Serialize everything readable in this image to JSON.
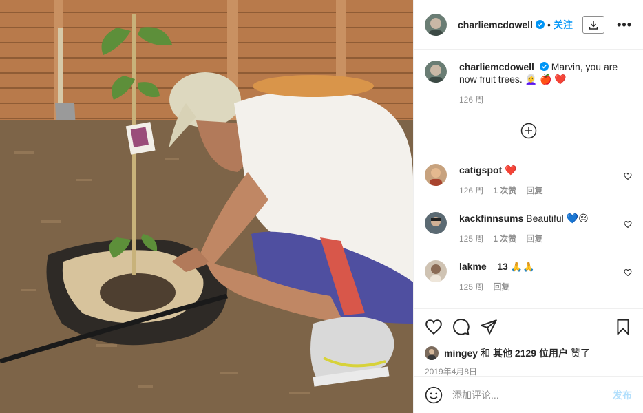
{
  "post": {
    "photo_icon": "photo"
  },
  "header": {
    "username": "charliemcdowell",
    "dot": "•",
    "follow_label": "关注",
    "download_icon": "download-icon",
    "more_label": "•••"
  },
  "caption": {
    "username": "charliemcdowell",
    "text": "Marvin, you are now fruit trees.",
    "emojis": "👩‍🦳 🍎 ❤️",
    "time": "126 周"
  },
  "comments": [
    {
      "username": "catigspot",
      "text": "",
      "emojis": "❤️",
      "time": "126 周",
      "likes": "",
      "reply": "回复"
    },
    {
      "username": "kackfinnsums",
      "text": "Beautiful",
      "emojis": "💙😔",
      "time": "125 周",
      "likes": "1 次赞",
      "reply": "回复"
    },
    {
      "username": "lakme__13",
      "text": "",
      "emojis": "🙏🙏",
      "time": "125 周",
      "likes": "",
      "reply": "回复"
    }
  ],
  "first_comment_likes": "1 次赞",
  "likes": {
    "user": "mingey",
    "joiner": "和",
    "others": "其他 2129 位用户",
    "suffix": "赞了"
  },
  "date": "2019年4月8日",
  "add_comment": {
    "placeholder": "添加评论...",
    "post_label": "发布"
  },
  "colors": {
    "accent": "#0095f6",
    "muted": "#8e8e8e",
    "text": "#262626"
  }
}
